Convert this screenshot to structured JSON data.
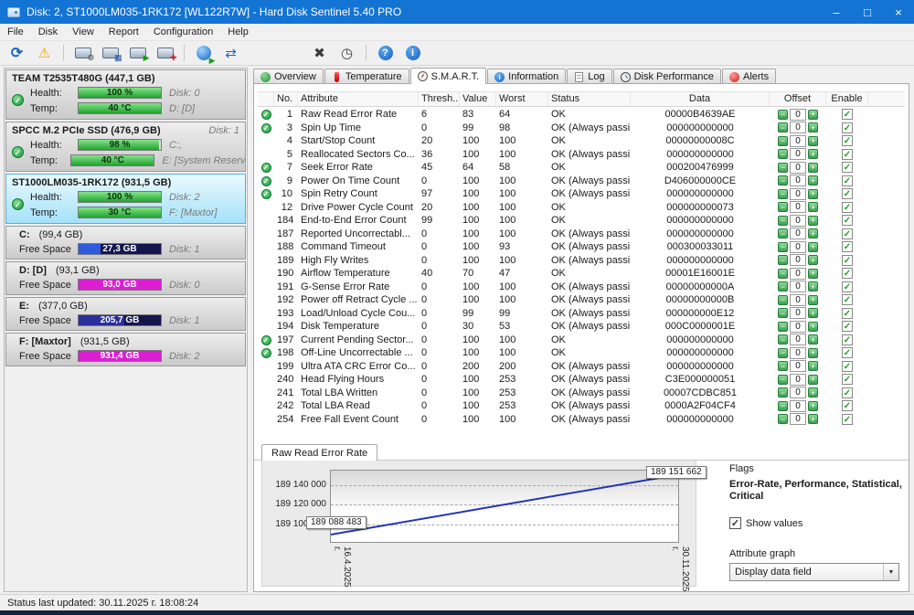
{
  "window": {
    "title": "Disk: 2, ST1000LM035-1RK172 [WL122R7W] - Hard Disk Sentinel 5.40 PRO",
    "controls": {
      "minimize": "–",
      "maximize": "□",
      "close": "×"
    }
  },
  "icons": {
    "check": "✓",
    "minus": "−",
    "plus": "+",
    "dropdown": "▼"
  },
  "colors": {
    "health_green": "#1fa32f",
    "partition_blue": "#2e5be0",
    "partition_magenta": "#dc1ed2",
    "partition_navy": "#2a2f9c",
    "graph_line": "#2136b6",
    "titlebar": "#1374d4"
  },
  "menu": {
    "items": [
      {
        "label": "File",
        "name": "menu-item-file"
      },
      {
        "label": "Disk",
        "name": "menu-item-disk"
      },
      {
        "label": "View",
        "name": "menu-item-view"
      },
      {
        "label": "Report",
        "name": "menu-item-report"
      },
      {
        "label": "Configuration",
        "name": "menu-item-configuration"
      },
      {
        "label": "Help",
        "name": "menu-item-help"
      }
    ]
  },
  "toolbar": {
    "buttons": [
      {
        "name": "refresh-button",
        "icon": "refresh-icon",
        "glyph": "⟳"
      },
      {
        "name": "alert-config-button",
        "icon": "warning-icon",
        "glyph": "⚠"
      },
      {
        "name": "disk-settings-button",
        "icon": "disk-gear-icon",
        "glyph": "⚙"
      },
      {
        "name": "disk-surface-test-button",
        "icon": "disk-surface-icon",
        "glyph": "▦"
      },
      {
        "name": "disk-self-test-button",
        "icon": "disk-play-icon",
        "glyph": "▶"
      },
      {
        "name": "disk-add-button",
        "icon": "disk-plus-icon",
        "glyph": "✚"
      },
      {
        "name": "disk-monitor-button",
        "icon": "sphere-play-icon",
        "glyph": "▶"
      },
      {
        "name": "disk-transfer-button",
        "icon": "transfer-icon",
        "glyph": "⇄"
      },
      {
        "name": "surface-map-button",
        "icon": "x-mark-icon",
        "glyph": "✖"
      },
      {
        "name": "clock-button",
        "icon": "clock-icon",
        "glyph": "◷"
      },
      {
        "name": "help-button",
        "icon": "help-icon",
        "glyph": "?"
      },
      {
        "name": "info-button",
        "icon": "info-icon",
        "glyph": "i"
      }
    ]
  },
  "sidebar": {
    "labels": {
      "health": "Health:",
      "temp": "Temp:",
      "free": "Free Space"
    },
    "disks": [
      {
        "name_attr": "disk-item-team",
        "cls": "",
        "name": "TEAM T2535T480G (447,1 GB)",
        "header_right": "",
        "health_value": "100 %",
        "health_pct": 100,
        "temp_value": "40 °C",
        "temp_pct": 100,
        "row1_right": "Disk: 0",
        "row2_right": "D: [D]"
      },
      {
        "name_attr": "disk-item-spcc",
        "cls": "",
        "name": "SPCC M.2 PCIe SSD (476,9 GB)",
        "header_right": "Disk: 1",
        "health_value": "98 %",
        "health_pct": 98,
        "temp_value": "40 °C",
        "temp_pct": 100,
        "row1_right": "C:,",
        "row2_right": "E:  [System Reserved]"
      },
      {
        "name_attr": "disk-item-st1000",
        "cls": "selected",
        "name": "ST1000LM035-1RK172 (931,5 GB)",
        "header_right": "",
        "health_value": "100 %",
        "health_pct": 100,
        "temp_value": "30 °C",
        "temp_pct": 100,
        "row1_right": "Disk: 2",
        "row2_right": "F: [Maxtor]"
      }
    ],
    "partitions": [
      {
        "name_attr": "partition-item-c",
        "name": "C:",
        "size": "(99,4 GB)",
        "free_value": "27,3 GB",
        "pct": 27,
        "color": "#2e5be0",
        "right": "Disk: 1"
      },
      {
        "name_attr": "partition-item-d",
        "name": "D: [D]",
        "size": "(93,1 GB)",
        "free_value": "93,0 GB",
        "pct": 100,
        "color": "#dc1ed2",
        "right": "Disk: 0"
      },
      {
        "name_attr": "partition-item-e",
        "name": "E:",
        "size": "(377,0 GB)",
        "free_value": "205,7 GB",
        "pct": 55,
        "color": "#2a2f9c",
        "right": "Disk: 1"
      },
      {
        "name_attr": "partition-item-f",
        "name": "F: [Maxtor]",
        "size": "(931,5 GB)",
        "free_value": "931,4 GB",
        "pct": 100,
        "color": "#dc1ed2",
        "right": "Disk: 2"
      }
    ]
  },
  "tabs": {
    "items": [
      {
        "label": "Overview",
        "name": "tab-overview",
        "icon": "overview-icon",
        "icon_cls": "ti-overview",
        "active_cls": ""
      },
      {
        "label": "Temperature",
        "name": "tab-temperature",
        "icon": "temperature-icon",
        "icon_cls": "ti-temp",
        "active_cls": ""
      },
      {
        "label": "S.M.A.R.T.",
        "name": "tab-smart",
        "icon": "gauge-icon",
        "icon_cls": "ti-smart",
        "active_cls": "active"
      },
      {
        "label": "Information",
        "name": "tab-information",
        "icon": "information-icon",
        "icon_cls": "ti-info",
        "active_cls": ""
      },
      {
        "label": "Log",
        "name": "tab-log",
        "icon": "log-icon",
        "icon_cls": "ti-log",
        "active_cls": ""
      },
      {
        "label": "Disk Performance",
        "name": "tab-disk-performance",
        "icon": "performance-icon",
        "icon_cls": "ti-perf",
        "active_cls": ""
      },
      {
        "label": "Alerts",
        "name": "tab-alerts",
        "icon": "alerts-icon",
        "icon_cls": "ti-alerts",
        "active_cls": ""
      }
    ]
  },
  "table": {
    "columns": [
      "No.",
      "Attribute",
      "Thresh...",
      "Value",
      "Worst",
      "Status",
      "Data",
      "Offset",
      "Enable"
    ],
    "offset_value": "0",
    "rows": [
      {
        "check": true,
        "no": "1",
        "attr": "Raw Read Error Rate",
        "thresh": "6",
        "value": "83",
        "worst": "64",
        "status": "OK",
        "data": "00000B4639AE"
      },
      {
        "check": true,
        "no": "3",
        "attr": "Spin Up Time",
        "thresh": "0",
        "value": "99",
        "worst": "98",
        "status": "OK (Always passing)",
        "data": "000000000000"
      },
      {
        "check": false,
        "no": "4",
        "attr": "Start/Stop Count",
        "thresh": "20",
        "value": "100",
        "worst": "100",
        "status": "OK",
        "data": "00000000008C"
      },
      {
        "check": false,
        "no": "5",
        "attr": "Reallocated Sectors Co...",
        "thresh": "36",
        "value": "100",
        "worst": "100",
        "status": "OK (Always passing)",
        "data": "000000000000"
      },
      {
        "check": true,
        "no": "7",
        "attr": "Seek Error Rate",
        "thresh": "45",
        "value": "64",
        "worst": "58",
        "status": "OK",
        "data": "000200476999"
      },
      {
        "check": true,
        "no": "9",
        "attr": "Power On Time Count",
        "thresh": "0",
        "value": "100",
        "worst": "100",
        "status": "OK (Always passing)",
        "data": "D406000000CE"
      },
      {
        "check": true,
        "no": "10",
        "attr": "Spin Retry Count",
        "thresh": "97",
        "value": "100",
        "worst": "100",
        "status": "OK (Always passing)",
        "data": "000000000000"
      },
      {
        "check": false,
        "no": "12",
        "attr": "Drive Power Cycle Count",
        "thresh": "20",
        "value": "100",
        "worst": "100",
        "status": "OK",
        "data": "000000000073"
      },
      {
        "check": false,
        "no": "184",
        "attr": "End-to-End Error Count",
        "thresh": "99",
        "value": "100",
        "worst": "100",
        "status": "OK",
        "data": "000000000000"
      },
      {
        "check": false,
        "no": "187",
        "attr": "Reported Uncorrectabl...",
        "thresh": "0",
        "value": "100",
        "worst": "100",
        "status": "OK (Always passing)",
        "data": "000000000000"
      },
      {
        "check": false,
        "no": "188",
        "attr": "Command Timeout",
        "thresh": "0",
        "value": "100",
        "worst": "93",
        "status": "OK (Always passing)",
        "data": "000300033011"
      },
      {
        "check": false,
        "no": "189",
        "attr": "High Fly Writes",
        "thresh": "0",
        "value": "100",
        "worst": "100",
        "status": "OK (Always passing)",
        "data": "000000000000"
      },
      {
        "check": false,
        "no": "190",
        "attr": "Airflow Temperature",
        "thresh": "40",
        "value": "70",
        "worst": "47",
        "status": "OK",
        "data": "00001E16001E"
      },
      {
        "check": false,
        "no": "191",
        "attr": "G-Sense Error Rate",
        "thresh": "0",
        "value": "100",
        "worst": "100",
        "status": "OK (Always passing)",
        "data": "00000000000A"
      },
      {
        "check": false,
        "no": "192",
        "attr": "Power off Retract Cycle ...",
        "thresh": "0",
        "value": "100",
        "worst": "100",
        "status": "OK (Always passing)",
        "data": "00000000000B"
      },
      {
        "check": false,
        "no": "193",
        "attr": "Load/Unload Cycle Cou...",
        "thresh": "0",
        "value": "99",
        "worst": "99",
        "status": "OK (Always passing)",
        "data": "000000000E12"
      },
      {
        "check": false,
        "no": "194",
        "attr": "Disk Temperature",
        "thresh": "0",
        "value": "30",
        "worst": "53",
        "status": "OK (Always passing)",
        "data": "000C0000001E"
      },
      {
        "check": true,
        "no": "197",
        "attr": "Current Pending Sector...",
        "thresh": "0",
        "value": "100",
        "worst": "100",
        "status": "OK",
        "data": "000000000000"
      },
      {
        "check": true,
        "no": "198",
        "attr": "Off-Line Uncorrectable ...",
        "thresh": "0",
        "value": "100",
        "worst": "100",
        "status": "OK",
        "data": "000000000000"
      },
      {
        "check": false,
        "no": "199",
        "attr": "Ultra ATA CRC Error Co...",
        "thresh": "0",
        "value": "200",
        "worst": "200",
        "status": "OK (Always passing)",
        "data": "000000000000"
      },
      {
        "check": false,
        "no": "240",
        "attr": "Head Flying Hours",
        "thresh": "0",
        "value": "100",
        "worst": "253",
        "status": "OK (Always passing)",
        "data": "C3E000000051"
      },
      {
        "check": false,
        "no": "241",
        "attr": "Total LBA Written",
        "thresh": "0",
        "value": "100",
        "worst": "253",
        "status": "OK (Always passing)",
        "data": "00007CDBC851"
      },
      {
        "check": false,
        "no": "242",
        "attr": "Total LBA Read",
        "thresh": "0",
        "value": "100",
        "worst": "253",
        "status": "OK (Always passing)",
        "data": "0000A2F04CF4"
      },
      {
        "check": false,
        "no": "254",
        "attr": "Free Fall Event Count",
        "thresh": "0",
        "value": "100",
        "worst": "100",
        "status": "OK (Always passing)",
        "data": "000000000000"
      }
    ]
  },
  "graph": {
    "tab": "Raw Read Error Rate",
    "yticks": [
      "189 140 000",
      "189 120 000",
      "189 100 000"
    ],
    "max_label": "189 151 662",
    "min_label": "189 088 483",
    "x_left": "16.4.2025 г.",
    "x_right": "30.11.2025 г."
  },
  "chart_data": {
    "type": "line",
    "title": "Raw Read Error Rate",
    "x": [
      "16.4.2025 г.",
      "30.11.2025 г."
    ],
    "values": [
      189088483,
      189151662
    ],
    "yticks": [
      189100000,
      189120000,
      189140000
    ],
    "ylim": [
      189080000,
      189160000
    ],
    "xlabel": "",
    "ylabel": "",
    "grid": true,
    "legend": "none",
    "line_color": "#2136b6",
    "annotations": [
      "189 088 483",
      "189 151 662"
    ]
  },
  "side": {
    "flags_label": "Flags",
    "flags_value": "Error-Rate, Performance, Statistical, Critical",
    "show_values": "Show values",
    "attribute_graph": "Attribute graph",
    "graph_mode": "Display data field"
  },
  "statusbar": {
    "text": "Status last updated: 30.11.2025 г. 18:08:24"
  }
}
